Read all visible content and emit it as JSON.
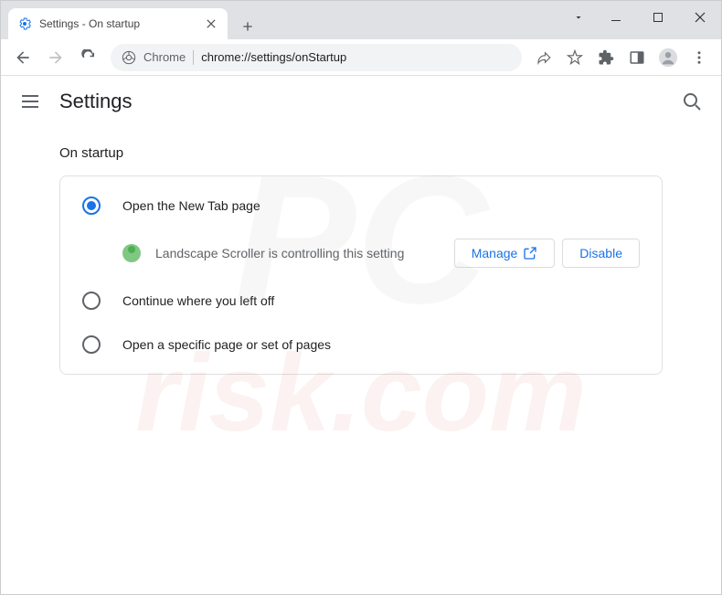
{
  "window": {
    "tab_title": "Settings - On startup"
  },
  "toolbar": {
    "chrome_label": "Chrome",
    "url": "chrome://settings/onStartup"
  },
  "header": {
    "title": "Settings"
  },
  "section": {
    "title": "On startup",
    "options": [
      {
        "label": "Open the New Tab page",
        "selected": true
      },
      {
        "label": "Continue where you left off",
        "selected": false
      },
      {
        "label": "Open a specific page or set of pages",
        "selected": false
      }
    ],
    "notice": {
      "text": "Landscape Scroller is controlling this setting",
      "manage_label": "Manage",
      "disable_label": "Disable"
    }
  }
}
